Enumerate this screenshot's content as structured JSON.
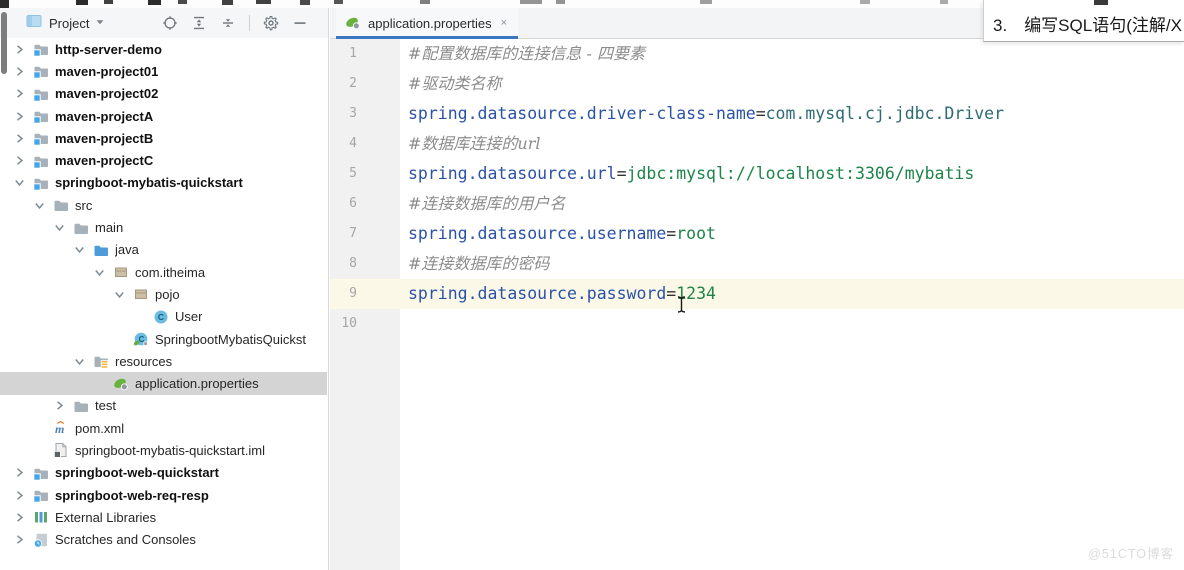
{
  "colors": {
    "tab_underline": "#3c76c1",
    "tree_selection": "#d4d4d4",
    "current_line_highlight": "#fbf8e7",
    "property_key": "#2b52a8",
    "property_value": "#1e8449",
    "class_value": "#2d6b73",
    "comment": "#8c8c8c"
  },
  "project_panel": {
    "title": "Project",
    "toolbar_icons": [
      "locate",
      "expand-all",
      "collapse-all",
      "divider",
      "settings-gear",
      "hide"
    ],
    "tree": [
      {
        "label": "http-server-demo",
        "level": 0,
        "chevron": "collapsed",
        "icon": "module-folder",
        "bold": true
      },
      {
        "label": "maven-project01",
        "level": 0,
        "chevron": "collapsed",
        "icon": "module-folder",
        "bold": true
      },
      {
        "label": "maven-project02",
        "level": 0,
        "chevron": "collapsed",
        "icon": "module-folder",
        "bold": true
      },
      {
        "label": "maven-projectA",
        "level": 0,
        "chevron": "collapsed",
        "icon": "module-folder",
        "bold": true
      },
      {
        "label": "maven-projectB",
        "level": 0,
        "chevron": "collapsed",
        "icon": "module-folder",
        "bold": true
      },
      {
        "label": "maven-projectC",
        "level": 0,
        "chevron": "collapsed",
        "icon": "module-folder",
        "bold": true
      },
      {
        "label": "springboot-mybatis-quickstart",
        "level": 0,
        "chevron": "expanded",
        "icon": "module-folder",
        "bold": true
      },
      {
        "label": "src",
        "level": 1,
        "chevron": "expanded",
        "icon": "folder"
      },
      {
        "label": "main",
        "level": 2,
        "chevron": "expanded",
        "icon": "folder"
      },
      {
        "label": "java",
        "level": 3,
        "chevron": "expanded",
        "icon": "sources-folder"
      },
      {
        "label": "com.itheima",
        "level": 4,
        "chevron": "expanded",
        "icon": "package"
      },
      {
        "label": "pojo",
        "level": 5,
        "chevron": "expanded",
        "icon": "package"
      },
      {
        "label": "User",
        "level": 6,
        "chevron": "none",
        "icon": "class"
      },
      {
        "label": "SpringbootMybatisQuickst",
        "level": 5,
        "chevron": "none",
        "icon": "springboot-class"
      },
      {
        "label": "resources",
        "level": 3,
        "chevron": "expanded",
        "icon": "resources-folder"
      },
      {
        "label": "application.properties",
        "level": 4,
        "chevron": "none",
        "icon": "spring-leaf",
        "selected": true
      },
      {
        "label": "test",
        "level": 2,
        "chevron": "collapsed",
        "icon": "folder"
      },
      {
        "label": "pom.xml",
        "level": 1,
        "chevron": "none",
        "icon": "maven"
      },
      {
        "label": "springboot-mybatis-quickstart.iml",
        "level": 1,
        "chevron": "none",
        "icon": "iml-file"
      },
      {
        "label": "springboot-web-quickstart",
        "level": 0,
        "chevron": "collapsed",
        "icon": "module-folder",
        "bold": true
      },
      {
        "label": "springboot-web-req-resp",
        "level": 0,
        "chevron": "collapsed",
        "icon": "module-folder",
        "bold": true
      },
      {
        "label": "External Libraries",
        "level": 0,
        "chevron": "collapsed",
        "icon": "external-libraries"
      },
      {
        "label": "Scratches and Consoles",
        "level": 0,
        "chevron": "collapsed",
        "icon": "scratches"
      }
    ]
  },
  "editor": {
    "tab": {
      "label": "application.properties",
      "icon": "spring-leaf",
      "close_label": "×"
    },
    "current_line": 9,
    "lines": [
      {
        "num": "1",
        "segments": [
          {
            "text": "#配置数据库的连接信息 - 四要素",
            "style": "comment"
          }
        ]
      },
      {
        "num": "2",
        "segments": [
          {
            "text": "#驱动类名称",
            "style": "comment"
          }
        ]
      },
      {
        "num": "3",
        "segments": [
          {
            "text": "spring.datasource.driver-class-name",
            "style": "key"
          },
          {
            "text": "=",
            "style": "eq"
          },
          {
            "text": "com.mysql.cj.jdbc.Driver",
            "style": "class_value"
          }
        ]
      },
      {
        "num": "4",
        "segments": [
          {
            "text": "#数据库连接的url",
            "style": "comment"
          }
        ]
      },
      {
        "num": "5",
        "segments": [
          {
            "text": "spring.datasource.url",
            "style": "key"
          },
          {
            "text": "=",
            "style": "eq"
          },
          {
            "text": "jdbc:mysql://localhost:3306/mybatis",
            "style": "value"
          }
        ]
      },
      {
        "num": "6",
        "segments": [
          {
            "text": "#连接数据库的用户名",
            "style": "comment"
          }
        ]
      },
      {
        "num": "7",
        "segments": [
          {
            "text": "spring.datasource.username",
            "style": "key"
          },
          {
            "text": "=",
            "style": "eq"
          },
          {
            "text": "root",
            "style": "value"
          }
        ]
      },
      {
        "num": "8",
        "segments": [
          {
            "text": "#连接数据库的密码",
            "style": "comment"
          }
        ]
      },
      {
        "num": "9",
        "segments": [
          {
            "text": "spring.datasource.password",
            "style": "key"
          },
          {
            "text": "=",
            "style": "eq"
          },
          {
            "text": "1234",
            "style": "value"
          }
        ]
      },
      {
        "num": "10",
        "segments": []
      }
    ]
  },
  "top_overlay": {
    "item_number": "3.",
    "text": "编写SQL语句(注解/X"
  },
  "watermark": "@51CTO博客"
}
